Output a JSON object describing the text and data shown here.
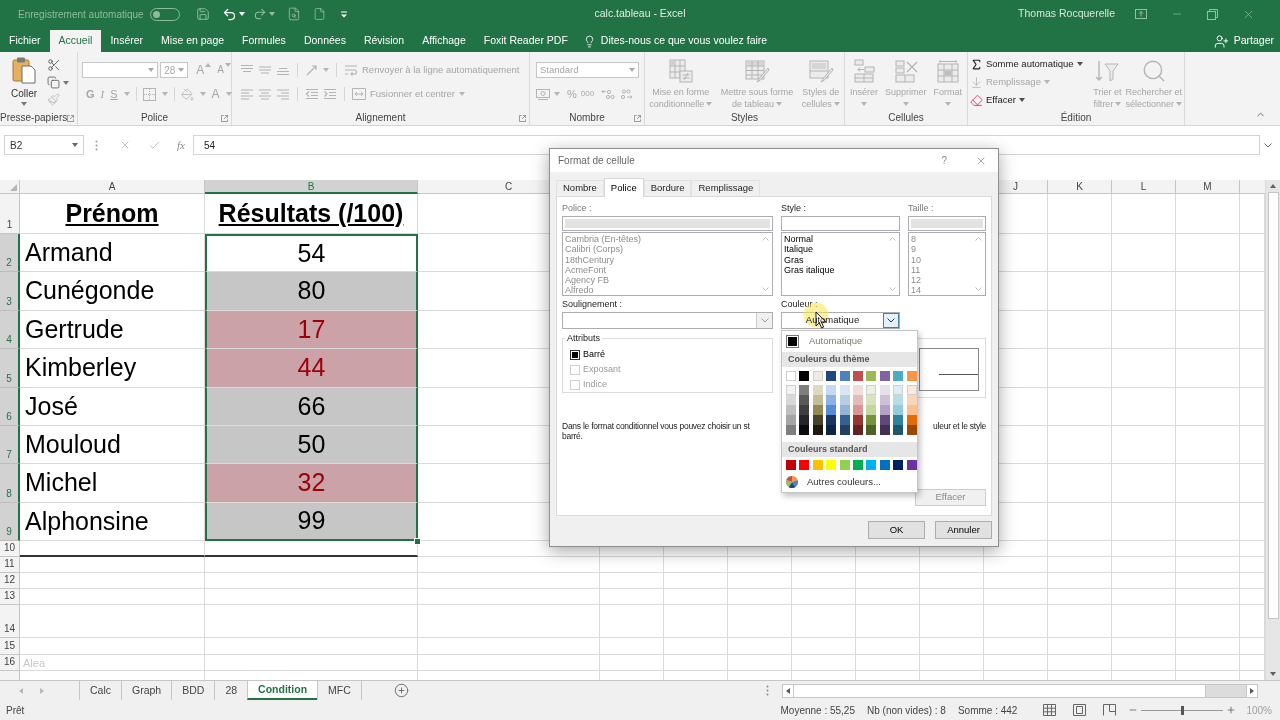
{
  "title_bar": {
    "autosave_label": "Enregistrement automatique",
    "autosave_on": false,
    "document_title": "calc.tableau - Excel",
    "user": "Thomas Rocquerelle"
  },
  "ribbon_tabs": [
    {
      "label": "Fichier",
      "selected": false
    },
    {
      "label": "Accueil",
      "selected": true
    },
    {
      "label": "Insérer",
      "selected": false
    },
    {
      "label": "Mise en page",
      "selected": false
    },
    {
      "label": "Formules",
      "selected": false
    },
    {
      "label": "Données",
      "selected": false
    },
    {
      "label": "Révision",
      "selected": false
    },
    {
      "label": "Affichage",
      "selected": false
    },
    {
      "label": "Foxit Reader PDF",
      "selected": false
    }
  ],
  "tell_me": "Dites-nous ce que vous voulez faire",
  "share_button": "Partager",
  "ribbon": {
    "clipboard": {
      "label": "Presse-papiers",
      "paste": "Coller",
      "disabled": false
    },
    "font": {
      "label": "Police",
      "size": "28",
      "grow": "A",
      "shrink": "A",
      "bold": "G",
      "italic": "I",
      "underline": "S",
      "font_color": "A",
      "disabled": true
    },
    "alignment": {
      "label": "Alignement",
      "wrap_text": "Renvoyer à la ligne automatiquement",
      "merge": "Fusionner et centrer",
      "disabled": true
    },
    "number": {
      "label": "Nombre",
      "format": "Standard",
      "percent": "%",
      "thousands": "000",
      "disabled": true
    },
    "styles": {
      "label": "Styles",
      "buttons": [
        {
          "kind": "conditional",
          "lines": [
            "Mise en forme",
            "conditionnelle"
          ],
          "disabled": true
        },
        {
          "kind": "table",
          "lines": [
            "Mettre sous forme",
            "de tableau"
          ],
          "disabled": true
        },
        {
          "kind": "cell_styles",
          "lines": [
            "Styles de",
            "cellules"
          ],
          "disabled": true
        }
      ]
    },
    "cells": {
      "label": "Cellules",
      "buttons": [
        {
          "kind": "insert",
          "lines": [
            "Insérer"
          ],
          "disabled": true
        },
        {
          "kind": "delete",
          "lines": [
            "Supprimer"
          ],
          "disabled": true
        },
        {
          "kind": "format",
          "lines": [
            "Format"
          ],
          "disabled": true
        }
      ]
    },
    "editing": {
      "label": "Édition",
      "small": [
        {
          "kind": "autosum",
          "label": "Somme automatique",
          "disabled": false
        },
        {
          "kind": "fill",
          "label": "Remplissage",
          "disabled": true
        },
        {
          "kind": "clear",
          "label": "Effacer",
          "disabled": false
        }
      ],
      "buttons": [
        {
          "kind": "sort",
          "lines": [
            "Trier et",
            "filtrer"
          ],
          "disabled": true
        },
        {
          "kind": "find",
          "lines": [
            "Rechercher et",
            "sélectionner"
          ],
          "disabled": true
        }
      ]
    }
  },
  "formula_bar": {
    "name_box": "B2",
    "insert_function": "fx",
    "formula": "54"
  },
  "sheet": {
    "columns_left": [
      {
        "label": "A",
        "selected": false
      },
      {
        "label": "B",
        "selected": true
      },
      {
        "label": "C",
        "selected": false
      }
    ],
    "columns_right": [
      {
        "label": "J"
      },
      {
        "label": "K"
      },
      {
        "label": "L"
      },
      {
        "label": "M"
      }
    ],
    "header_row": {
      "row": "1",
      "cells": [
        "Prénom",
        "Résultats (/100)"
      ]
    },
    "rows": [
      {
        "row": "2",
        "name": "Armand",
        "score": "54",
        "flagged": false,
        "selected": true,
        "active": true
      },
      {
        "row": "3",
        "name": "Cunégonde",
        "score": "80",
        "flagged": false,
        "selected": true,
        "active": false
      },
      {
        "row": "4",
        "name": "Gertrude",
        "score": "17",
        "flagged": true,
        "selected": true,
        "active": false
      },
      {
        "row": "5",
        "name": "Kimberley",
        "score": "44",
        "flagged": true,
        "selected": true,
        "active": false
      },
      {
        "row": "6",
        "name": "José",
        "score": "66",
        "flagged": false,
        "selected": true,
        "active": false
      },
      {
        "row": "7",
        "name": "Mouloud",
        "score": "50",
        "flagged": false,
        "selected": true,
        "active": false
      },
      {
        "row": "8",
        "name": "Michel",
        "score": "32",
        "flagged": true,
        "selected": true,
        "active": false
      },
      {
        "row": "9",
        "name": "Alphonsine",
        "score": "99",
        "flagged": false,
        "selected": true,
        "active": false
      }
    ],
    "empty_rows": [
      {
        "row": "10"
      },
      {
        "row": "11"
      },
      {
        "row": "12"
      },
      {
        "row": "13"
      },
      {
        "row": "14"
      },
      {
        "row": "15"
      },
      {
        "row": "16",
        "note": "Alea"
      }
    ]
  },
  "dialog": {
    "title": "Format de cellule",
    "help": "?",
    "tabs": [
      {
        "label": "Nombre",
        "selected": false
      },
      {
        "label": "Police",
        "selected": true
      },
      {
        "label": "Bordure",
        "selected": false
      },
      {
        "label": "Remplissage",
        "selected": false
      }
    ],
    "font": {
      "label": "Police :",
      "items": [
        "Cambria (En-têtes)",
        "Calibri (Corps)",
        "18thCentury",
        "AcmeFont",
        "Agency FB",
        "Alfredo"
      ],
      "disabled": true
    },
    "style": {
      "label": "Style :",
      "items": [
        "Normal",
        "Italique",
        "Gras",
        "Gras italique"
      ],
      "disabled": false
    },
    "size": {
      "label": "Taille :",
      "items": [
        "8",
        "9",
        "10",
        "11",
        "12",
        "14"
      ],
      "disabled": true
    },
    "underline": {
      "label": "Soulignement :",
      "disabled": true
    },
    "color": {
      "label": "Couleur :",
      "value": "Automatique",
      "expanded": true
    },
    "attributes": {
      "label": "Attributs",
      "items": [
        {
          "label": "Barré",
          "checked": false,
          "indeterminate": true,
          "disabled": false
        },
        {
          "label": "Exposant",
          "checked": false,
          "indeterminate": false,
          "disabled": true
        },
        {
          "label": "Indice",
          "checked": false,
          "indeterminate": false,
          "disabled": true
        }
      ]
    },
    "note_start": "Dans le format conditionnel vous pouvez choisir un st",
    "note_end": "uleur et le style",
    "note_last_line": "barré.",
    "clear_button": "Effacer",
    "ok_button": "OK",
    "cancel_button": "Annuler",
    "color_menu": {
      "automatic": {
        "label": "Automatique",
        "color": "#000000"
      },
      "theme_header": "Couleurs du thème",
      "theme_colors": [
        {
          "color": "#ffffff"
        },
        {
          "color": "#000000"
        },
        {
          "color": "#eeece1"
        },
        {
          "color": "#1f497d"
        },
        {
          "color": "#4f81bd"
        },
        {
          "color": "#c0504d"
        },
        {
          "color": "#9bbb59"
        },
        {
          "color": "#8064a2"
        },
        {
          "color": "#4bacc6"
        },
        {
          "color": "#f79646"
        }
      ],
      "theme_shades": [
        {
          "swatches": [
            {
              "color": "#f2f2f2"
            },
            {
              "color": "#7f7f7f"
            },
            {
              "color": "#ddd9c3"
            },
            {
              "color": "#c6d9f0"
            },
            {
              "color": "#dbe5f1"
            },
            {
              "color": "#f2dcdb"
            },
            {
              "color": "#ebf1dd"
            },
            {
              "color": "#e5e0ec"
            },
            {
              "color": "#dbeef3"
            },
            {
              "color": "#fdeada"
            }
          ]
        },
        {
          "swatches": [
            {
              "color": "#d8d8d8"
            },
            {
              "color": "#595959"
            },
            {
              "color": "#c4bd97"
            },
            {
              "color": "#8db3e2"
            },
            {
              "color": "#b8cce4"
            },
            {
              "color": "#e5b9b7"
            },
            {
              "color": "#d7e3bc"
            },
            {
              "color": "#ccc1d9"
            },
            {
              "color": "#b7dde8"
            },
            {
              "color": "#fbd5b5"
            }
          ]
        },
        {
          "swatches": [
            {
              "color": "#bfbfbf"
            },
            {
              "color": "#3f3f3f"
            },
            {
              "color": "#938953"
            },
            {
              "color": "#548dd4"
            },
            {
              "color": "#95b3d7"
            },
            {
              "color": "#d99694"
            },
            {
              "color": "#c3d69b"
            },
            {
              "color": "#b2a2c7"
            },
            {
              "color": "#92cddc"
            },
            {
              "color": "#fac08f"
            }
          ]
        },
        {
          "swatches": [
            {
              "color": "#a5a5a5"
            },
            {
              "color": "#262626"
            },
            {
              "color": "#494429"
            },
            {
              "color": "#17365d"
            },
            {
              "color": "#366092"
            },
            {
              "color": "#953734"
            },
            {
              "color": "#76923c"
            },
            {
              "color": "#5f497a"
            },
            {
              "color": "#31859b"
            },
            {
              "color": "#e36c09"
            }
          ]
        },
        {
          "swatches": [
            {
              "color": "#7f7f7f"
            },
            {
              "color": "#0c0c0c"
            },
            {
              "color": "#1d1b10"
            },
            {
              "color": "#0f243e"
            },
            {
              "color": "#244061"
            },
            {
              "color": "#632423"
            },
            {
              "color": "#4f6128"
            },
            {
              "color": "#3f3151"
            },
            {
              "color": "#205867"
            },
            {
              "color": "#974806"
            }
          ]
        }
      ],
      "standard_header": "Couleurs standard",
      "standard_colors": [
        {
          "color": "#c00000"
        },
        {
          "color": "#ff0000"
        },
        {
          "color": "#ffc000"
        },
        {
          "color": "#ffff00"
        },
        {
          "color": "#92d050"
        },
        {
          "color": "#00b050"
        },
        {
          "color": "#00b0f0"
        },
        {
          "color": "#0070c0"
        },
        {
          "color": "#002060"
        },
        {
          "color": "#7030a0"
        }
      ],
      "more_colors": "Autres couleurs..."
    }
  },
  "sheet_tabs": [
    {
      "label": "Calc",
      "selected": false
    },
    {
      "label": "Graph",
      "selected": false
    },
    {
      "label": "BDD",
      "selected": false
    },
    {
      "label": "28",
      "selected": false
    },
    {
      "label": "Condition",
      "selected": true
    },
    {
      "label": "MFC",
      "selected": false
    }
  ],
  "status_bar": {
    "mode": "Prêt",
    "stats": [
      "Moyenne : 55,25",
      "Nb (non vides) : 8",
      "Somme : 442"
    ],
    "zoom_slider": {
      "level": 0.5
    },
    "zoom": "100%"
  }
}
